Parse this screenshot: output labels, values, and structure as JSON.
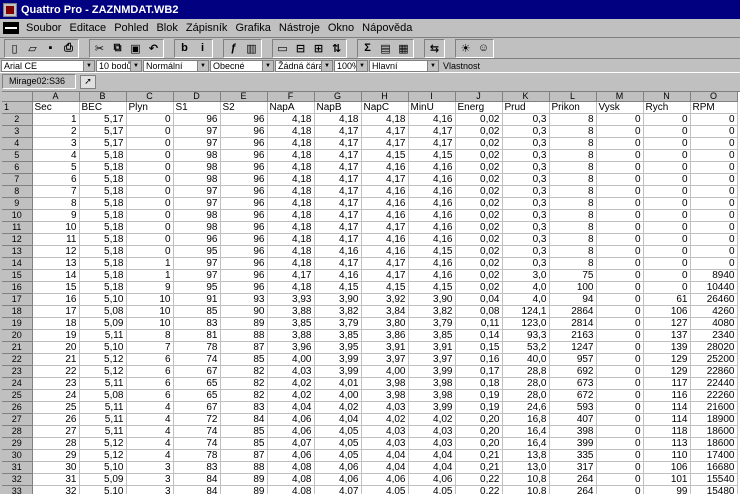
{
  "window": {
    "title": "Quattro Pro - ZAZNMDAT.WB2"
  },
  "menu": [
    "Soubor",
    "Editace",
    "Pohled",
    "Blok",
    "Zápisník",
    "Grafika",
    "Nástroje",
    "Okno",
    "Nápověda"
  ],
  "toolbar": {
    "buttons": [
      {
        "name": "new-file-icon",
        "glyph": "▯"
      },
      {
        "name": "open-file-icon",
        "glyph": "▱"
      },
      {
        "name": "save-icon",
        "glyph": "▪"
      },
      {
        "name": "print-icon",
        "glyph": "⎙"
      },
      {
        "name": "cut-icon",
        "glyph": "✂"
      },
      {
        "name": "copy-icon",
        "glyph": "⧉"
      },
      {
        "name": "paste-icon",
        "glyph": "▣"
      },
      {
        "name": "undo-icon",
        "glyph": "↶"
      },
      {
        "name": "bold-icon",
        "glyph": "b"
      },
      {
        "name": "italic-icon",
        "glyph": "i"
      },
      {
        "name": "function-icon",
        "glyph": "ƒ"
      },
      {
        "name": "chart-icon",
        "glyph": "▥"
      },
      {
        "name": "insert-icon",
        "glyph": "▭"
      },
      {
        "name": "delete-icon",
        "glyph": "⊟"
      },
      {
        "name": "fit-icon",
        "glyph": "⊞"
      },
      {
        "name": "sort-az-icon",
        "glyph": "⇅"
      },
      {
        "name": "sum-icon",
        "glyph": "Σ"
      },
      {
        "name": "style-icon",
        "glyph": "▤"
      },
      {
        "name": "grid-icon",
        "glyph": "▦"
      },
      {
        "name": "transpose-icon",
        "glyph": "⇆"
      },
      {
        "name": "bulb-icon",
        "glyph": "☀"
      },
      {
        "name": "expert-icon",
        "glyph": "☺"
      }
    ]
  },
  "propbar": {
    "font": "Arial CE",
    "size": "10 bodů",
    "style": "Normální",
    "numfmt": "Obecné",
    "line": "Žádná čára",
    "zoom": "100%",
    "page": "Hlavní",
    "props": "Vlastnost"
  },
  "input": {
    "cell_ref": "Mirage02:S36",
    "value": ""
  },
  "sheet": {
    "columns": [
      "A",
      "B",
      "C",
      "D",
      "E",
      "F",
      "G",
      "H",
      "I",
      "J",
      "K",
      "L",
      "M",
      "N",
      "O"
    ],
    "header_row": [
      "Sec",
      "BEC",
      "Plyn",
      "S1",
      "S2",
      "NapA",
      "NapB",
      "NapC",
      "MinU",
      "Energ",
      "Prud",
      "Prikon",
      "Vysk",
      "Rych",
      "RPM"
    ],
    "rows": [
      [
        "1",
        "5,17",
        "0",
        "96",
        "96",
        "4,18",
        "4,18",
        "4,18",
        "4,16",
        "0,02",
        "0,3",
        "8",
        "0",
        "0",
        "0"
      ],
      [
        "2",
        "5,17",
        "0",
        "97",
        "96",
        "4,18",
        "4,17",
        "4,17",
        "4,17",
        "0,02",
        "0,3",
        "8",
        "0",
        "0",
        "0"
      ],
      [
        "3",
        "5,17",
        "0",
        "97",
        "96",
        "4,18",
        "4,17",
        "4,17",
        "4,17",
        "0,02",
        "0,3",
        "8",
        "0",
        "0",
        "0"
      ],
      [
        "4",
        "5,18",
        "0",
        "98",
        "96",
        "4,18",
        "4,17",
        "4,15",
        "4,15",
        "0,02",
        "0,3",
        "8",
        "0",
        "0",
        "0"
      ],
      [
        "5",
        "5,18",
        "0",
        "98",
        "96",
        "4,18",
        "4,17",
        "4,16",
        "4,16",
        "0,02",
        "0,3",
        "8",
        "0",
        "0",
        "0"
      ],
      [
        "6",
        "5,18",
        "0",
        "98",
        "96",
        "4,18",
        "4,17",
        "4,17",
        "4,16",
        "0,02",
        "0,3",
        "8",
        "0",
        "0",
        "0"
      ],
      [
        "7",
        "5,18",
        "0",
        "97",
        "96",
        "4,18",
        "4,17",
        "4,16",
        "4,16",
        "0,02",
        "0,3",
        "8",
        "0",
        "0",
        "0"
      ],
      [
        "8",
        "5,18",
        "0",
        "97",
        "96",
        "4,18",
        "4,17",
        "4,16",
        "4,16",
        "0,02",
        "0,3",
        "8",
        "0",
        "0",
        "0"
      ],
      [
        "9",
        "5,18",
        "0",
        "98",
        "96",
        "4,18",
        "4,17",
        "4,16",
        "4,16",
        "0,02",
        "0,3",
        "8",
        "0",
        "0",
        "0"
      ],
      [
        "10",
        "5,18",
        "0",
        "98",
        "96",
        "4,18",
        "4,17",
        "4,17",
        "4,16",
        "0,02",
        "0,3",
        "8",
        "0",
        "0",
        "0"
      ],
      [
        "11",
        "5,18",
        "0",
        "96",
        "96",
        "4,18",
        "4,17",
        "4,16",
        "4,16",
        "0,02",
        "0,3",
        "8",
        "0",
        "0",
        "0"
      ],
      [
        "12",
        "5,18",
        "0",
        "95",
        "96",
        "4,18",
        "4,16",
        "4,16",
        "4,15",
        "0,02",
        "0,3",
        "8",
        "0",
        "0",
        "0"
      ],
      [
        "13",
        "5,18",
        "1",
        "97",
        "96",
        "4,18",
        "4,17",
        "4,17",
        "4,16",
        "0,02",
        "0,3",
        "8",
        "0",
        "0",
        "0"
      ],
      [
        "14",
        "5,18",
        "1",
        "97",
        "96",
        "4,17",
        "4,16",
        "4,17",
        "4,16",
        "0,02",
        "3,0",
        "75",
        "0",
        "0",
        "8940"
      ],
      [
        "15",
        "5,18",
        "9",
        "95",
        "96",
        "4,18",
        "4,15",
        "4,15",
        "4,15",
        "0,02",
        "4,0",
        "100",
        "0",
        "0",
        "10440"
      ],
      [
        "16",
        "5,10",
        "10",
        "91",
        "93",
        "3,93",
        "3,90",
        "3,92",
        "3,90",
        "0,04",
        "4,0",
        "94",
        "0",
        "61",
        "26460"
      ],
      [
        "17",
        "5,08",
        "10",
        "85",
        "90",
        "3,88",
        "3,82",
        "3,84",
        "3,82",
        "0,08",
        "124,1",
        "2864",
        "0",
        "106",
        "4260"
      ],
      [
        "18",
        "5,09",
        "10",
        "83",
        "89",
        "3,85",
        "3,79",
        "3,80",
        "3,79",
        "0,11",
        "123,0",
        "2814",
        "0",
        "127",
        "4080"
      ],
      [
        "19",
        "5,11",
        "8",
        "81",
        "88",
        "3,88",
        "3,85",
        "3,86",
        "3,85",
        "0,14",
        "93,3",
        "2163",
        "0",
        "137",
        "2340"
      ],
      [
        "20",
        "5,10",
        "7",
        "78",
        "87",
        "3,96",
        "3,95",
        "3,91",
        "3,91",
        "0,15",
        "53,2",
        "1247",
        "0",
        "139",
        "28020"
      ],
      [
        "21",
        "5,12",
        "6",
        "74",
        "85",
        "4,00",
        "3,99",
        "3,97",
        "3,97",
        "0,16",
        "40,0",
        "957",
        "0",
        "129",
        "25200"
      ],
      [
        "22",
        "5,12",
        "6",
        "67",
        "82",
        "4,03",
        "3,99",
        "4,00",
        "3,99",
        "0,17",
        "28,8",
        "692",
        "0",
        "129",
        "22860"
      ],
      [
        "23",
        "5,11",
        "6",
        "65",
        "82",
        "4,02",
        "4,01",
        "3,98",
        "3,98",
        "0,18",
        "28,0",
        "673",
        "0",
        "117",
        "22440"
      ],
      [
        "24",
        "5,08",
        "6",
        "65",
        "82",
        "4,02",
        "4,00",
        "3,98",
        "3,98",
        "0,19",
        "28,0",
        "672",
        "0",
        "116",
        "22260"
      ],
      [
        "25",
        "5,11",
        "4",
        "67",
        "83",
        "4,04",
        "4,02",
        "4,03",
        "3,99",
        "0,19",
        "24,6",
        "593",
        "0",
        "114",
        "21600"
      ],
      [
        "26",
        "5,11",
        "4",
        "72",
        "84",
        "4,06",
        "4,04",
        "4,02",
        "4,02",
        "0,20",
        "16,8",
        "407",
        "0",
        "114",
        "18900"
      ],
      [
        "27",
        "5,11",
        "4",
        "74",
        "85",
        "4,06",
        "4,05",
        "4,03",
        "4,03",
        "0,20",
        "16,4",
        "398",
        "0",
        "118",
        "18600"
      ],
      [
        "28",
        "5,12",
        "4",
        "74",
        "85",
        "4,07",
        "4,05",
        "4,03",
        "4,03",
        "0,20",
        "16,4",
        "399",
        "0",
        "113",
        "18600"
      ],
      [
        "29",
        "5,12",
        "4",
        "78",
        "87",
        "4,06",
        "4,05",
        "4,04",
        "4,04",
        "0,21",
        "13,8",
        "335",
        "0",
        "110",
        "17400"
      ],
      [
        "30",
        "5,10",
        "3",
        "83",
        "88",
        "4,08",
        "4,06",
        "4,04",
        "4,04",
        "0,21",
        "13,0",
        "317",
        "0",
        "106",
        "16680"
      ],
      [
        "31",
        "5,09",
        "3",
        "84",
        "89",
        "4,08",
        "4,06",
        "4,06",
        "4,06",
        "0,22",
        "10,8",
        "264",
        "0",
        "101",
        "15540"
      ],
      [
        "32",
        "5,10",
        "3",
        "84",
        "89",
        "4,08",
        "4,07",
        "4,05",
        "4,05",
        "0,22",
        "10,8",
        "264",
        "0",
        "99",
        "15480"
      ]
    ]
  },
  "colors": {
    "titlebar": "#000080",
    "chrome": "#c0c0c0",
    "grid": "#c0c0c0"
  }
}
